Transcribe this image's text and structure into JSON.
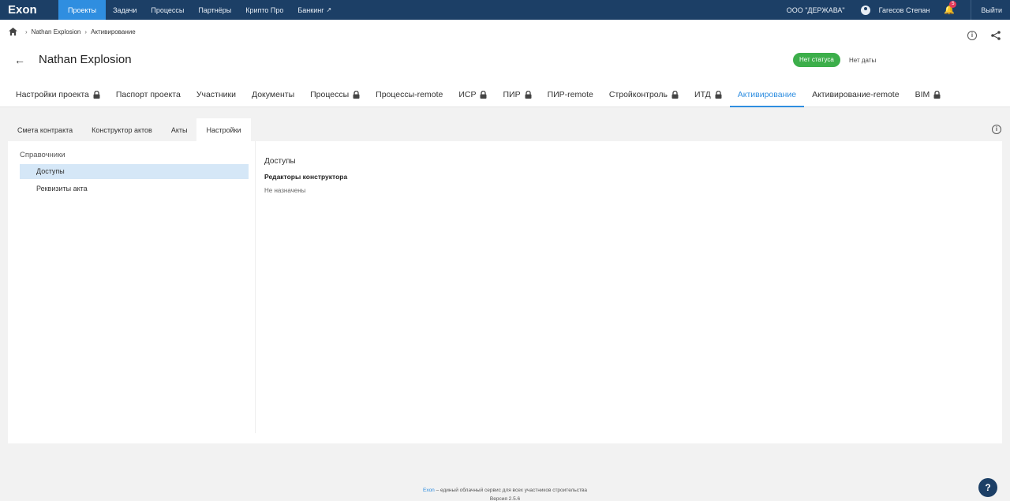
{
  "app": {
    "logo": "Exon"
  },
  "topnav": {
    "items": [
      {
        "label": "Проекты",
        "active": true
      },
      {
        "label": "Задачи"
      },
      {
        "label": "Процессы"
      },
      {
        "label": "Партнёры"
      },
      {
        "label": "Крипто Про"
      },
      {
        "label": "Банкинг"
      }
    ],
    "org": "ООО \"ДЕРЖАВА\"",
    "user": "Гагесов Степан",
    "notifications_count": "5",
    "logout": "Выйти"
  },
  "breadcrumb": {
    "project": "Nathan Explosion",
    "current": "Активирование"
  },
  "page": {
    "title": "Nathan Explosion",
    "status": "Нет статуса",
    "date": "Нет даты"
  },
  "tabs": [
    {
      "label": "Настройки проекта",
      "locked": true
    },
    {
      "label": "Паспорт проекта"
    },
    {
      "label": "Участники"
    },
    {
      "label": "Документы"
    },
    {
      "label": "Процессы",
      "locked": true
    },
    {
      "label": "Процессы-remote"
    },
    {
      "label": "ИСР",
      "locked": true
    },
    {
      "label": "ПИР",
      "locked": true
    },
    {
      "label": "ПИР-remote"
    },
    {
      "label": "Стройконтроль",
      "locked": true
    },
    {
      "label": "ИТД",
      "locked": true
    },
    {
      "label": "Активирование",
      "active": true
    },
    {
      "label": "Активирование-remote"
    },
    {
      "label": "BIM",
      "locked": true
    }
  ],
  "subtabs": [
    {
      "label": "Смета контракта"
    },
    {
      "label": "Конструктор актов"
    },
    {
      "label": "Акты"
    },
    {
      "label": "Настройки",
      "active": true
    }
  ],
  "sidebar": {
    "heading": "Справочники",
    "items": [
      {
        "label": "Доступы",
        "selected": true
      },
      {
        "label": "Реквизиты акта"
      }
    ]
  },
  "content": {
    "title": "Доступы",
    "subtitle": "Редакторы конструктора",
    "value": "Не назначены"
  },
  "footer": {
    "brand": "Exon",
    "tagline": " – единый облачный сервис для всех участников строительства",
    "version": "Версия 2.5.6"
  },
  "colors": {
    "topbar": "#1c3f66",
    "accent": "#2f8ee0",
    "status": "#3cae4a",
    "badge": "#e23a5a"
  }
}
